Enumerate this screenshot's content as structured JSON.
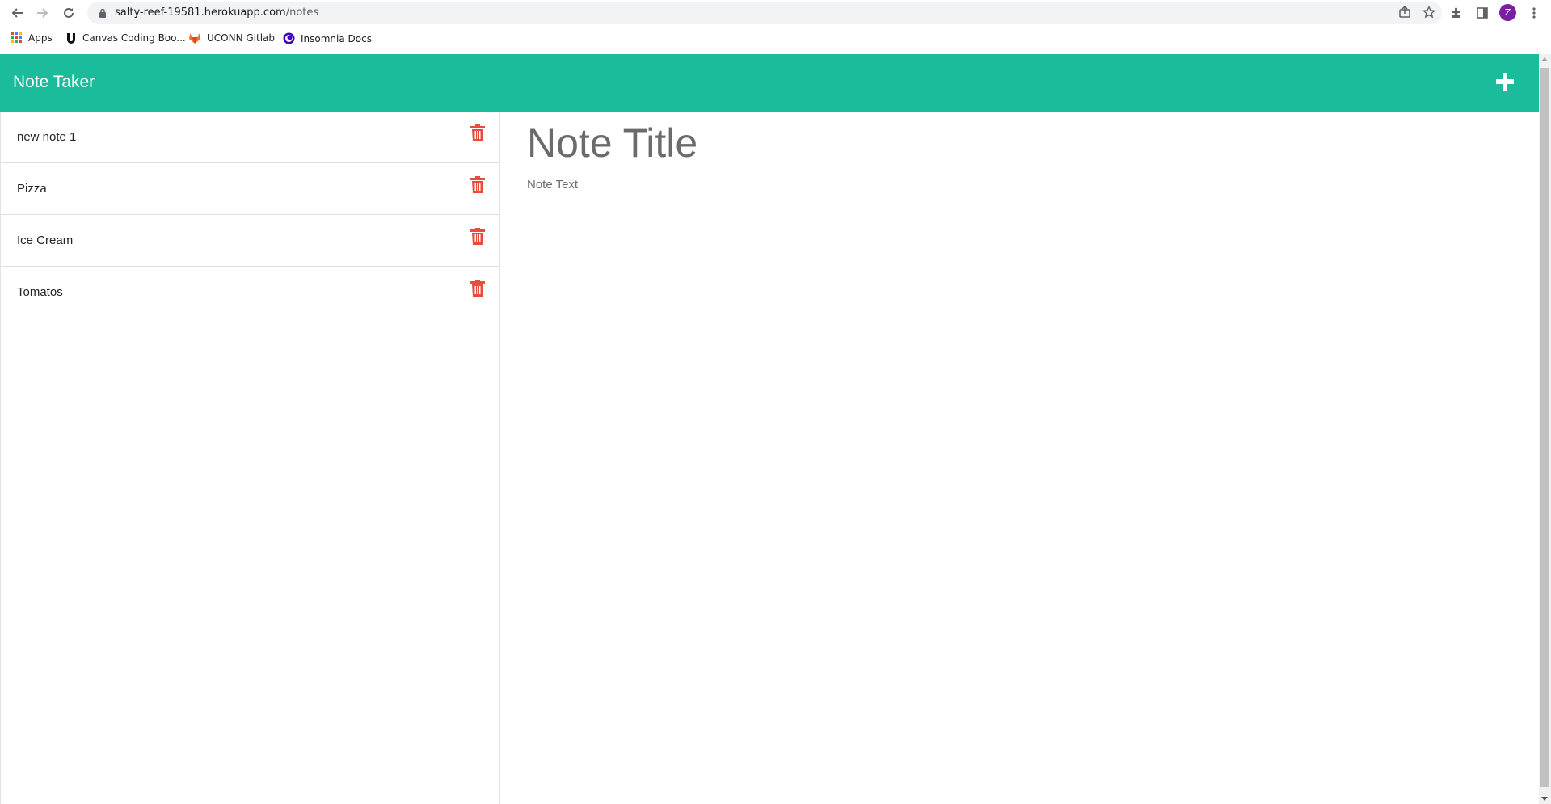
{
  "browser": {
    "url_host": "salty-reef-19581.herokuapp.com",
    "url_path": "/notes",
    "profile_initial": "Z"
  },
  "bookmarks": [
    {
      "label": "Apps",
      "icon": "apps-grid-icon"
    },
    {
      "label": "Canvas Coding Boo...",
      "icon": "uconn-u-icon"
    },
    {
      "label": "UCONN Gitlab",
      "icon": "gitlab-fox-icon"
    },
    {
      "label": "Insomnia Docs",
      "icon": "insomnia-icon"
    }
  ],
  "app": {
    "title": "Note Taker",
    "header_color": "#1abc9c",
    "add_icon": "plus-icon"
  },
  "notes": [
    {
      "title": "new note 1"
    },
    {
      "title": "Pizza"
    },
    {
      "title": "Ice Cream"
    },
    {
      "title": "Tomatos"
    }
  ],
  "delete_icon_color": "#e74c3c",
  "editor": {
    "title_placeholder": "Note Title",
    "text_placeholder": "Note Text"
  }
}
